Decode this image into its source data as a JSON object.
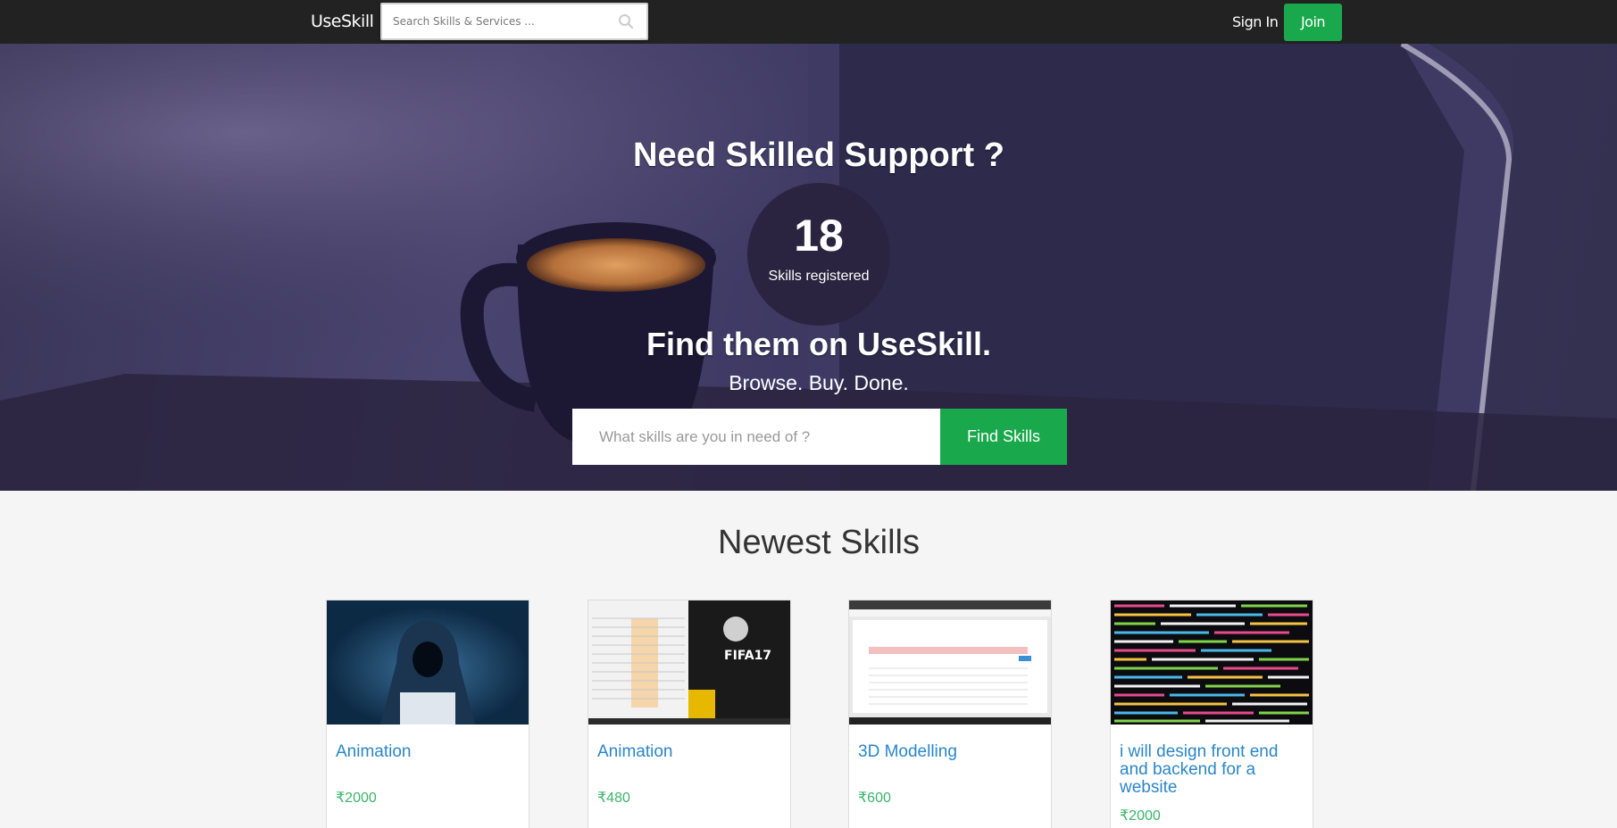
{
  "navbar": {
    "brand": "UseSkill",
    "search_placeholder": "Search Skills & Services ...",
    "signin_label": "Sign In",
    "join_label": "Join"
  },
  "hero": {
    "title": "Need Skilled Support ?",
    "counter_value": "18",
    "counter_label": "Skills registered",
    "subtitle": "Find them on UseSkill.",
    "tagline": "Browse. Buy. Done.",
    "search_placeholder": "What skills are you in need of ?",
    "find_button": "Find Skills"
  },
  "newest": {
    "title": "Newest Skills",
    "cards": [
      {
        "name": "Animation",
        "price": "₹2000",
        "thumb": "hooded-hacker-image"
      },
      {
        "name": "Animation",
        "price": "₹480",
        "thumb": "fifa17-screenshot-image"
      },
      {
        "name": "3D Modelling",
        "price": "₹600",
        "thumb": "website-screenshot-image"
      },
      {
        "name": "i will design front end and backend for a website",
        "price": "₹2000",
        "thumb": "colorful-code-image"
      }
    ]
  },
  "colors": {
    "navbar": "#222222",
    "accent_green": "#1aa84c",
    "link_blue": "#2a86c9",
    "price_green": "#39b56a"
  }
}
